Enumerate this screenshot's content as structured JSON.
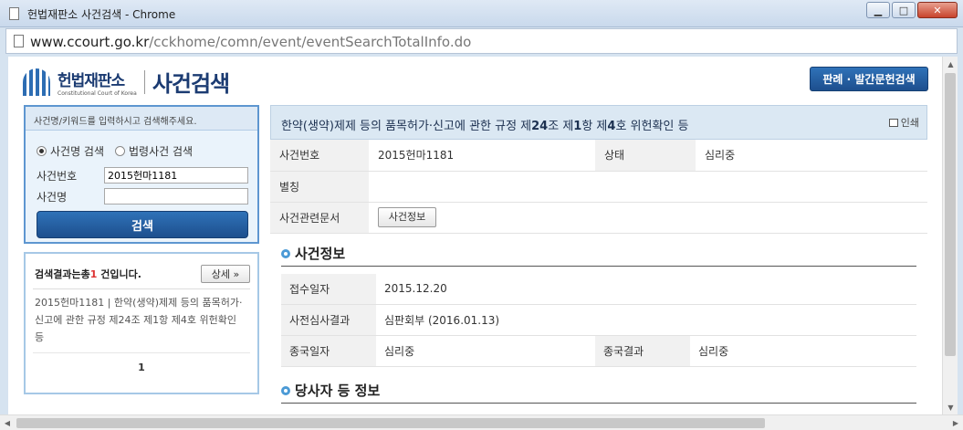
{
  "window": {
    "title": "헌법재판소 사건검색 - Chrome",
    "minimize": "▁",
    "maximize": "□",
    "close": "✕"
  },
  "address": {
    "host": "www.ccourt.go.kr",
    "path": "/cckhome/comn/event/eventSearchTotalInfo.do"
  },
  "header": {
    "org_kor": "헌법재판소",
    "org_eng": "Constitutional Court of Korea",
    "page_title": "사건검색",
    "top_button": "판례 · 발간문헌검색"
  },
  "search": {
    "guide": "사건명/키워드를 입력하시고 검색해주세요.",
    "radio_case_name": "사건명 검색",
    "radio_law": "법령사건 검색",
    "case_number_label": "사건번호",
    "case_number_value": "2015헌마1181",
    "case_name_label": "사건명",
    "case_name_value": "",
    "button": "검색"
  },
  "results": {
    "prefix": "검색결과는총",
    "count": "1",
    "suffix": " 건입니다.",
    "detail_button": "상세 »",
    "item": "2015헌마1181 | 한약(생약)제제 등의 품목허가·신고에 관한 규정 제24조 제1항 제4호 위헌확인 등",
    "page": "1"
  },
  "case": {
    "title_pre": "한약(생약)제제 등의 품목허가·신고에 관한 규정 제",
    "art": "24",
    "title_mid1": "조 제",
    "para": "1",
    "title_mid2": "항 제",
    "item": "4",
    "title_post": "호 위헌확인 등",
    "print": "인쇄",
    "rows": {
      "case_no_label": "사건번호",
      "case_no": "2015헌마1181",
      "status_label": "상태",
      "status": "심리중",
      "alias_label": "별칭",
      "alias": "",
      "docs_label": "사건관련문서",
      "docs_button": "사건정보"
    }
  },
  "case_info": {
    "heading": "사건정보",
    "received_label": "접수일자",
    "received": "2015.12.20",
    "prelim_label": "사전심사결과",
    "prelim": "심판회부 (2016.01.13)",
    "end_date_label": "종국일자",
    "end_date": "심리중",
    "end_result_label": "종국결과",
    "end_result": "심리중"
  },
  "party_info": {
    "heading": "당사자 등 정보"
  }
}
